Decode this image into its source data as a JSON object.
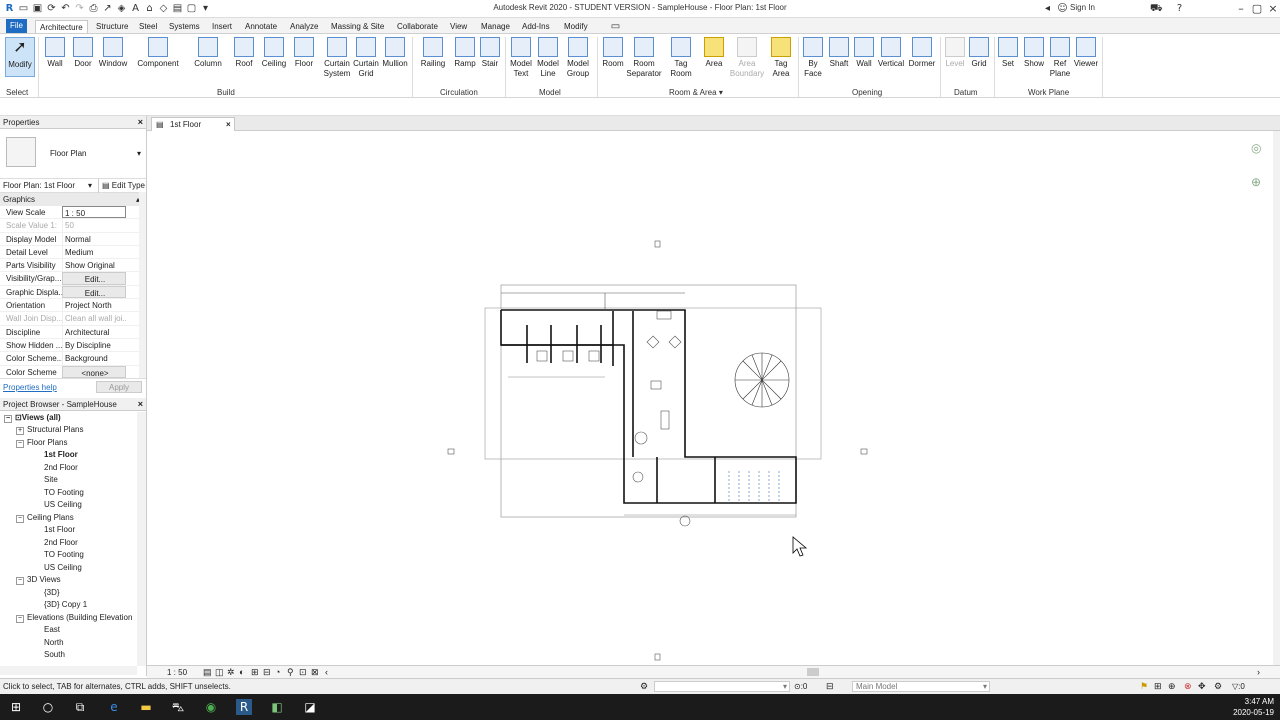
{
  "titlebar": {
    "title": "Autodesk Revit 2020 - STUDENT VERSION - SampleHouse - Floor Plan: 1st Floor",
    "signin": "Sign In"
  },
  "ribbon_tabs": [
    "File",
    "Architecture",
    "Structure",
    "Steel",
    "Systems",
    "Insert",
    "Annotate",
    "Analyze",
    "Massing & Site",
    "Collaborate",
    "View",
    "Manage",
    "Add-Ins",
    "Modify"
  ],
  "ribbon": {
    "select_label": "Select",
    "tools": [
      {
        "label": "Modify",
        "sub": ""
      },
      {
        "label": "Wall",
        "sub": ""
      },
      {
        "label": "Door",
        "sub": ""
      },
      {
        "label": "Window",
        "sub": ""
      },
      {
        "label": "Component",
        "sub": ""
      },
      {
        "label": "Column",
        "sub": ""
      },
      {
        "label": "Roof",
        "sub": ""
      },
      {
        "label": "Ceiling",
        "sub": ""
      },
      {
        "label": "Floor",
        "sub": ""
      },
      {
        "label": "Curtain",
        "sub": "System"
      },
      {
        "label": "Curtain",
        "sub": "Grid"
      },
      {
        "label": "Mullion",
        "sub": ""
      },
      {
        "label": "Railing",
        "sub": ""
      },
      {
        "label": "Ramp",
        "sub": ""
      },
      {
        "label": "Stair",
        "sub": ""
      },
      {
        "label": "Model",
        "sub": "Text"
      },
      {
        "label": "Model",
        "sub": "Line"
      },
      {
        "label": "Model",
        "sub": "Group"
      },
      {
        "label": "Room",
        "sub": ""
      },
      {
        "label": "Room",
        "sub": "Separator"
      },
      {
        "label": "Tag",
        "sub": "Room"
      },
      {
        "label": "Area",
        "sub": ""
      },
      {
        "label": "Area",
        "sub": "Boundary"
      },
      {
        "label": "Tag",
        "sub": "Area"
      },
      {
        "label": "By",
        "sub": "Face"
      },
      {
        "label": "Shaft",
        "sub": ""
      },
      {
        "label": "Wall",
        "sub": ""
      },
      {
        "label": "Vertical",
        "sub": ""
      },
      {
        "label": "Dormer",
        "sub": ""
      },
      {
        "label": "Level",
        "sub": ""
      },
      {
        "label": "Grid",
        "sub": ""
      },
      {
        "label": "Set",
        "sub": ""
      },
      {
        "label": "Show",
        "sub": ""
      },
      {
        "label": "Ref",
        "sub": "Plane"
      },
      {
        "label": "Viewer",
        "sub": ""
      }
    ],
    "groups": [
      "Build",
      "Circulation",
      "Model",
      "Room & Area",
      "Opening",
      "Datum",
      "Work Plane"
    ]
  },
  "properties": {
    "title": "Properties",
    "type_name": "Floor Plan",
    "instance": "Floor Plan: 1st Floor",
    "edit_type": "Edit Type",
    "section": "Graphics",
    "rows": [
      {
        "k": "View Scale",
        "v": "1 : 50"
      },
      {
        "k": "Scale Value    1:",
        "v": "50"
      },
      {
        "k": "Display Model",
        "v": "Normal"
      },
      {
        "k": "Detail Level",
        "v": "Medium"
      },
      {
        "k": "Parts Visibility",
        "v": "Show Original"
      },
      {
        "k": "Visibility/Grap...",
        "v": "Edit..."
      },
      {
        "k": "Graphic Displa...",
        "v": "Edit..."
      },
      {
        "k": "Orientation",
        "v": "Project North"
      },
      {
        "k": "Wall Join Disp...",
        "v": "Clean all wall joi..."
      },
      {
        "k": "Discipline",
        "v": "Architectural"
      },
      {
        "k": "Show Hidden ...",
        "v": "By Discipline"
      },
      {
        "k": "Color Scheme...",
        "v": "Background"
      },
      {
        "k": "Color Scheme",
        "v": "<none>"
      }
    ],
    "help": "Properties help",
    "apply": "Apply"
  },
  "browser": {
    "title": "Project Browser - SampleHouse",
    "nodes": [
      {
        "label": "Views (all)",
        "indent": 0
      },
      {
        "label": "Structural Plans",
        "indent": 1
      },
      {
        "label": "Floor Plans",
        "indent": 1
      },
      {
        "label": "1st Floor",
        "indent": 2
      },
      {
        "label": "2nd Floor",
        "indent": 2
      },
      {
        "label": "Site",
        "indent": 2
      },
      {
        "label": "TO Footing",
        "indent": 2
      },
      {
        "label": "US Ceiling",
        "indent": 2
      },
      {
        "label": "Ceiling Plans",
        "indent": 1
      },
      {
        "label": "1st Floor",
        "indent": 2
      },
      {
        "label": "2nd Floor",
        "indent": 2
      },
      {
        "label": "TO Footing",
        "indent": 2
      },
      {
        "label": "US Ceiling",
        "indent": 2
      },
      {
        "label": "3D Views",
        "indent": 1
      },
      {
        "label": "{3D}",
        "indent": 2
      },
      {
        "label": "{3D} Copy 1",
        "indent": 2
      },
      {
        "label": "Elevations (Building Elevation",
        "indent": 1
      },
      {
        "label": "East",
        "indent": 2
      },
      {
        "label": "North",
        "indent": 2
      },
      {
        "label": "South",
        "indent": 2
      }
    ]
  },
  "view_tab": "1st Floor",
  "view_scale": "1 : 50",
  "status": {
    "text": "Click to select, TAB for alternates, CTRL adds, SHIFT unselects.",
    "zero": ":0",
    "model": "Main Model",
    "filter": ":0"
  },
  "clock": {
    "time": "3:47 AM",
    "date": "2020-05-19"
  },
  "colors": {
    "accent": "#1f6dc2",
    "taskbar": "#1b1b1b"
  }
}
